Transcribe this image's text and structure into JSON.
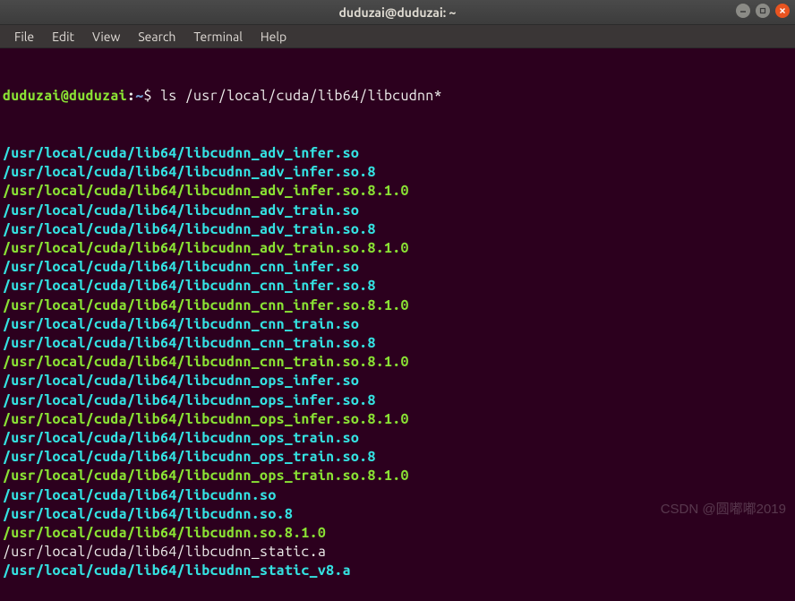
{
  "window": {
    "title": "duduzai@duduzai: ~"
  },
  "menu": {
    "items": [
      "File",
      "Edit",
      "View",
      "Search",
      "Terminal",
      "Help"
    ]
  },
  "prompt": {
    "user": "duduzai",
    "at": "@",
    "host": "duduzai",
    "colon": ":",
    "path": "~",
    "dollar": "$ ",
    "command": "ls /usr/local/cuda/lib64/libcudnn*"
  },
  "output": [
    {
      "text": "/usr/local/cuda/lib64/libcudnn_adv_infer.so",
      "cls": "cyan"
    },
    {
      "text": "/usr/local/cuda/lib64/libcudnn_adv_infer.so.8",
      "cls": "cyan"
    },
    {
      "text": "/usr/local/cuda/lib64/libcudnn_adv_infer.so.8.1.0",
      "cls": "green"
    },
    {
      "text": "/usr/local/cuda/lib64/libcudnn_adv_train.so",
      "cls": "cyan"
    },
    {
      "text": "/usr/local/cuda/lib64/libcudnn_adv_train.so.8",
      "cls": "cyan"
    },
    {
      "text": "/usr/local/cuda/lib64/libcudnn_adv_train.so.8.1.0",
      "cls": "green"
    },
    {
      "text": "/usr/local/cuda/lib64/libcudnn_cnn_infer.so",
      "cls": "cyan"
    },
    {
      "text": "/usr/local/cuda/lib64/libcudnn_cnn_infer.so.8",
      "cls": "cyan"
    },
    {
      "text": "/usr/local/cuda/lib64/libcudnn_cnn_infer.so.8.1.0",
      "cls": "green"
    },
    {
      "text": "/usr/local/cuda/lib64/libcudnn_cnn_train.so",
      "cls": "cyan"
    },
    {
      "text": "/usr/local/cuda/lib64/libcudnn_cnn_train.so.8",
      "cls": "cyan"
    },
    {
      "text": "/usr/local/cuda/lib64/libcudnn_cnn_train.so.8.1.0",
      "cls": "green"
    },
    {
      "text": "/usr/local/cuda/lib64/libcudnn_ops_infer.so",
      "cls": "cyan"
    },
    {
      "text": "/usr/local/cuda/lib64/libcudnn_ops_infer.so.8",
      "cls": "cyan"
    },
    {
      "text": "/usr/local/cuda/lib64/libcudnn_ops_infer.so.8.1.0",
      "cls": "green"
    },
    {
      "text": "/usr/local/cuda/lib64/libcudnn_ops_train.so",
      "cls": "cyan"
    },
    {
      "text": "/usr/local/cuda/lib64/libcudnn_ops_train.so.8",
      "cls": "cyan"
    },
    {
      "text": "/usr/local/cuda/lib64/libcudnn_ops_train.so.8.1.0",
      "cls": "green"
    },
    {
      "text": "/usr/local/cuda/lib64/libcudnn.so",
      "cls": "cyan"
    },
    {
      "text": "/usr/local/cuda/lib64/libcudnn.so.8",
      "cls": "cyan"
    },
    {
      "text": "/usr/local/cuda/lib64/libcudnn.so.8.1.0",
      "cls": "green"
    },
    {
      "text": "/usr/local/cuda/lib64/libcudnn_static.a",
      "cls": "plain"
    },
    {
      "text": "/usr/local/cuda/lib64/libcudnn_static_v8.a",
      "cls": "cyan"
    }
  ],
  "watermark": "CSDN @圆嘟嘟2019"
}
